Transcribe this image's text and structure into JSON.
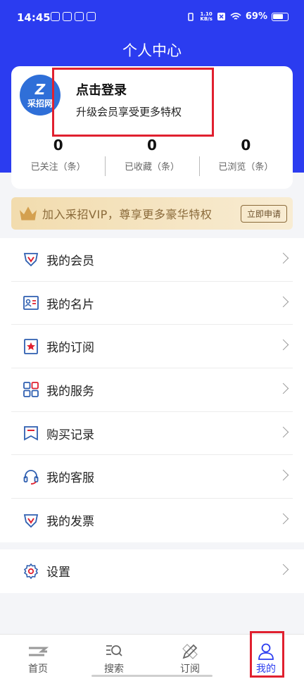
{
  "status_bar": {
    "time": "14:45",
    "speed_value": "1.10",
    "speed_unit": "KB/s",
    "battery": "69%"
  },
  "page_title": "个人中心",
  "profile": {
    "logo_text": "采招网",
    "login_title": "点击登录",
    "login_subtitle": "升级会员享受更多特权",
    "stats": [
      {
        "value": "0",
        "label": "已关注（条）"
      },
      {
        "value": "0",
        "label": "已收藏（条）"
      },
      {
        "value": "0",
        "label": "已浏览（条）"
      }
    ]
  },
  "vip_banner": {
    "text": "加入采招VIP，尊享更多豪华特权",
    "button_label": "立即申请"
  },
  "menu": {
    "items": [
      {
        "label": "我的会员",
        "icon": "vip-badge-icon"
      },
      {
        "label": "我的名片",
        "icon": "business-card-icon"
      },
      {
        "label": "我的订阅",
        "icon": "subscription-star-icon"
      },
      {
        "label": "我的服务",
        "icon": "service-grid-icon"
      },
      {
        "label": "购买记录",
        "icon": "purchase-record-icon"
      },
      {
        "label": "我的客服",
        "icon": "headset-icon"
      },
      {
        "label": "我的发票",
        "icon": "invoice-icon"
      }
    ],
    "settings_label": "设置"
  },
  "tab_bar": {
    "tabs": [
      {
        "label": "首页"
      },
      {
        "label": "搜索"
      },
      {
        "label": "订阅"
      },
      {
        "label": "我的"
      }
    ],
    "active_color": "#2b3cf0"
  },
  "colors": {
    "brand_blue": "#2b3cf0",
    "highlight_red": "#e0202f",
    "vip_gold": "#d4a04f",
    "icon_blue": "#2f5fb0",
    "icon_red": "#e0202f"
  }
}
